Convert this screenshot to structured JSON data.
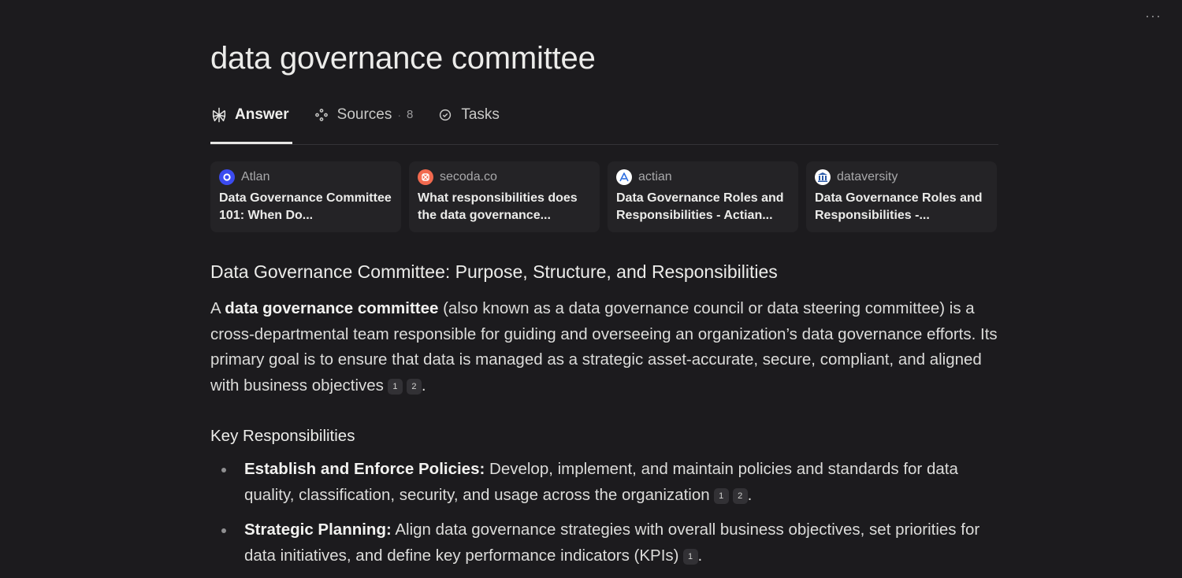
{
  "query": "data governance committee",
  "menu_label": "···",
  "tabs": [
    {
      "label": "Answer",
      "icon": "perplexity-icon"
    },
    {
      "label": "Sources",
      "icon": "sources-icon",
      "separator": "·",
      "count": "8"
    },
    {
      "label": "Tasks",
      "icon": "check-circle-icon"
    }
  ],
  "sources": [
    {
      "site": "Atlan",
      "title": "Data Governance Committee 101: When Do...",
      "icon": "atlan-icon",
      "color": "#3b4bf0"
    },
    {
      "site": "secoda.co",
      "title": "What responsibilities does the data governance...",
      "icon": "secoda-icon",
      "color": "#f26a4f"
    },
    {
      "site": "actian",
      "title": "Data Governance Roles and Responsibilities - Actian...",
      "icon": "actian-icon",
      "color": "#2f6fe0"
    },
    {
      "site": "dataversity",
      "title": "Data Governance Roles and Responsibilities -...",
      "icon": "dataversity-icon",
      "color": "#2a5aa8"
    }
  ],
  "answer": {
    "title": "Data Governance Committee: Purpose, Structure, and Responsibilities",
    "intro": {
      "prefix": "A ",
      "bold": "data governance committee",
      "rest": " (also known as a data governance council or data steering committee) is a cross-departmental team responsible for guiding and overseeing an organization’s data governance efforts. Its primary goal is to ensure that data is managed as a strategic asset-accurate, secure, compliant, and aligned with business objectives",
      "citations": [
        "1",
        "2"
      ],
      "end": "."
    },
    "section_title": "Key Responsibilities",
    "items": [
      {
        "bold": "Establish and Enforce Policies:",
        "text": " Develop, implement, and maintain policies and standards for data quality, classification, security, and usage across the organization",
        "citations": [
          "1",
          "2"
        ],
        "end": "."
      },
      {
        "bold": "Strategic Planning:",
        "text": " Align data governance strategies with overall business objectives, set priorities for data initiatives, and define key performance indicators (KPIs)",
        "citations": [
          "1"
        ],
        "end": "."
      }
    ]
  }
}
